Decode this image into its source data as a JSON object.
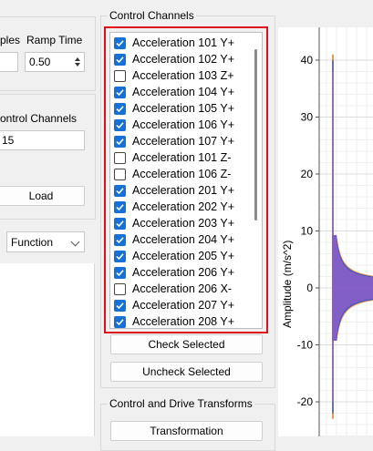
{
  "left_panel": {
    "samples_label": "ples",
    "ramp_time_label": "Ramp Time",
    "ramp_time_value": "0.50",
    "control_channels_label": "ontrol Channels",
    "control_channels_value": "15",
    "load_button": "Load",
    "function_select": "Function"
  },
  "control_channels": {
    "title": "Control Channels",
    "items": [
      {
        "label": "Acceleration 101 Y+",
        "checked": true
      },
      {
        "label": "Acceleration 102 Y+",
        "checked": true
      },
      {
        "label": "Acceleration 103 Z+",
        "checked": false
      },
      {
        "label": "Acceleration 104 Y+",
        "checked": true
      },
      {
        "label": "Acceleration 105 Y+",
        "checked": true
      },
      {
        "label": "Acceleration 106 Y+",
        "checked": true
      },
      {
        "label": "Acceleration 107 Y+",
        "checked": true
      },
      {
        "label": "Acceleration 101 Z-",
        "checked": false
      },
      {
        "label": "Acceleration 106 Z-",
        "checked": false
      },
      {
        "label": "Acceleration 201 Y+",
        "checked": true
      },
      {
        "label": "Acceleration 202 Y+",
        "checked": true
      },
      {
        "label": "Acceleration 203 Y+",
        "checked": true
      },
      {
        "label": "Acceleration 204 Y+",
        "checked": true
      },
      {
        "label": "Acceleration 205 Y+",
        "checked": true
      },
      {
        "label": "Acceleration 206 Y+",
        "checked": true
      },
      {
        "label": "Acceleration 206 X-",
        "checked": false
      },
      {
        "label": "Acceleration 207 Y+",
        "checked": true
      },
      {
        "label": "Acceleration 208 Y+",
        "checked": true
      }
    ],
    "check_selected_button": "Check Selected",
    "uncheck_selected_button": "Uncheck Selected"
  },
  "transforms": {
    "title": "Control and Drive Transforms",
    "transformation_button": "Transformation"
  },
  "plot": {
    "ylabel": "Amplitude (m/s^2)",
    "y_ticks": [
      "40",
      "30",
      "20",
      "10",
      "0",
      "-10",
      "-20"
    ]
  },
  "colors": {
    "accent": "#1570d8",
    "highlight_frame": "#e0101a",
    "series_orange": "#f07f1a",
    "series_blue": "#3055c8",
    "series_purple": "#8a5fc8"
  }
}
